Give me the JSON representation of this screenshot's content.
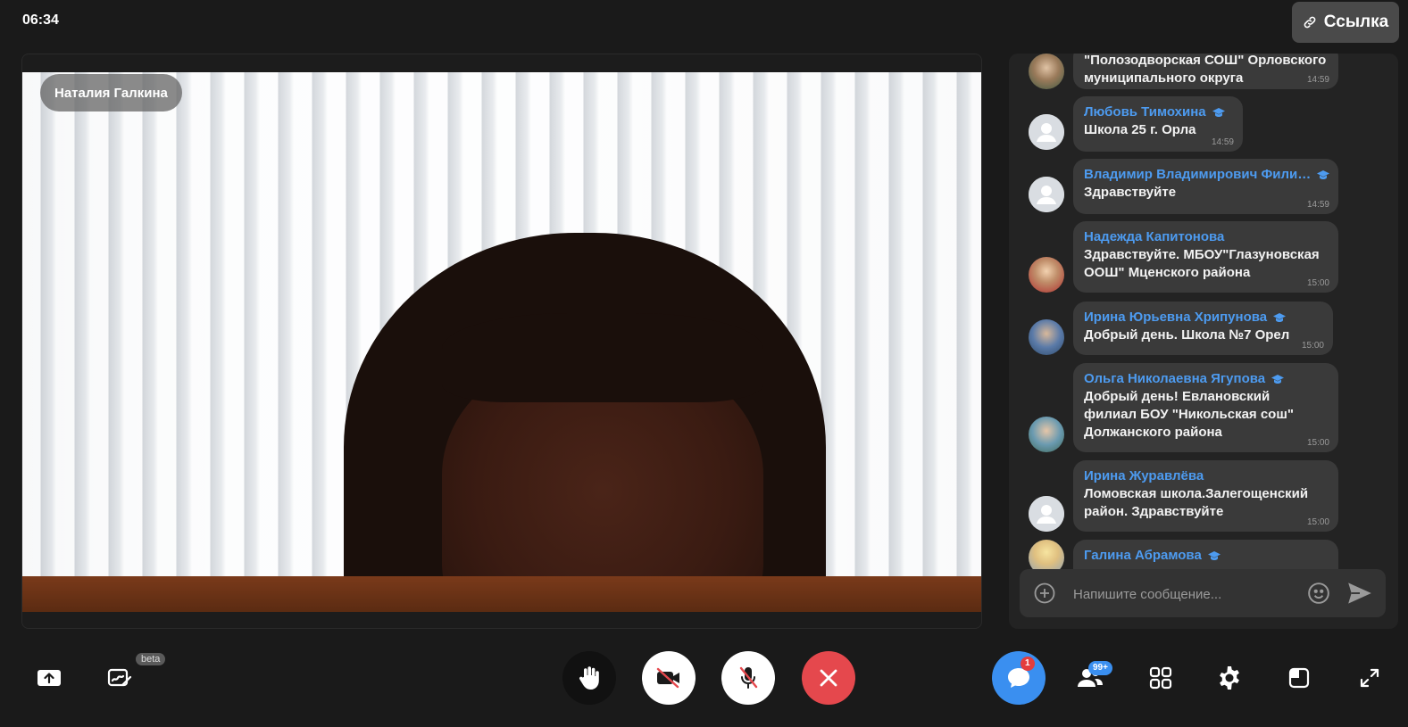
{
  "header": {
    "time": "06:34",
    "link_label": "Ссылка"
  },
  "video": {
    "participant_name": "Наталия Галкина"
  },
  "chat": {
    "messages": [
      {
        "sender": "",
        "text": "\"Полозодворская СОШ\" Орловского муниципального округа",
        "time": "14:59",
        "avatar": "photo",
        "verified": false
      },
      {
        "sender": "Любовь Тимохина",
        "text": "Школа 25 г. Орла",
        "time": "14:59",
        "avatar": "default",
        "verified": true
      },
      {
        "sender": "Владимир Владимирович Фили…",
        "text": "Здравствуйте",
        "time": "14:59",
        "avatar": "default",
        "verified": true
      },
      {
        "sender": "Надежда Капитонова",
        "text": "Здравствуйте. МБОУ\"Глазуновская ООШ\" Мценского района",
        "time": "15:00",
        "avatar": "photo",
        "verified": false
      },
      {
        "sender": "Ирина Юрьевна Хрипунова",
        "text": "Добрый день. Школа №7 Орел",
        "time": "15:00",
        "avatar": "photo",
        "verified": true
      },
      {
        "sender": "Ольга Николаевна Ягупова",
        "text": "Добрый день! Евлановский филиал БОУ \"Никольская сош\" Должанского района",
        "time": "15:00",
        "avatar": "photo",
        "verified": true
      },
      {
        "sender": "Ирина Журавлёва",
        "text": "Ломовская школа.Залегощенский район. Здравствуйте",
        "time": "15:00",
        "avatar": "default",
        "verified": false
      },
      {
        "sender": "Галина Абрамова",
        "text": "",
        "time": "",
        "avatar": "photo",
        "verified": true
      }
    ],
    "input_placeholder": "Напишите сообщение..."
  },
  "toolbar": {
    "beta_label": "beta",
    "chat_badge": "1",
    "participants_badge": "99+",
    "icons": [
      "share-screen-icon",
      "whiteboard-icon",
      "raise-hand-icon",
      "camera-off-icon",
      "mic-off-icon",
      "end-call-icon",
      "chat-icon",
      "participants-icon",
      "grid-layout-icon",
      "settings-icon",
      "layout-icon",
      "fullscreen-icon"
    ],
    "colors": {
      "end_call": "#e5484d",
      "chat_active": "#3a8ff0",
      "round_button": "#ffffff"
    }
  }
}
